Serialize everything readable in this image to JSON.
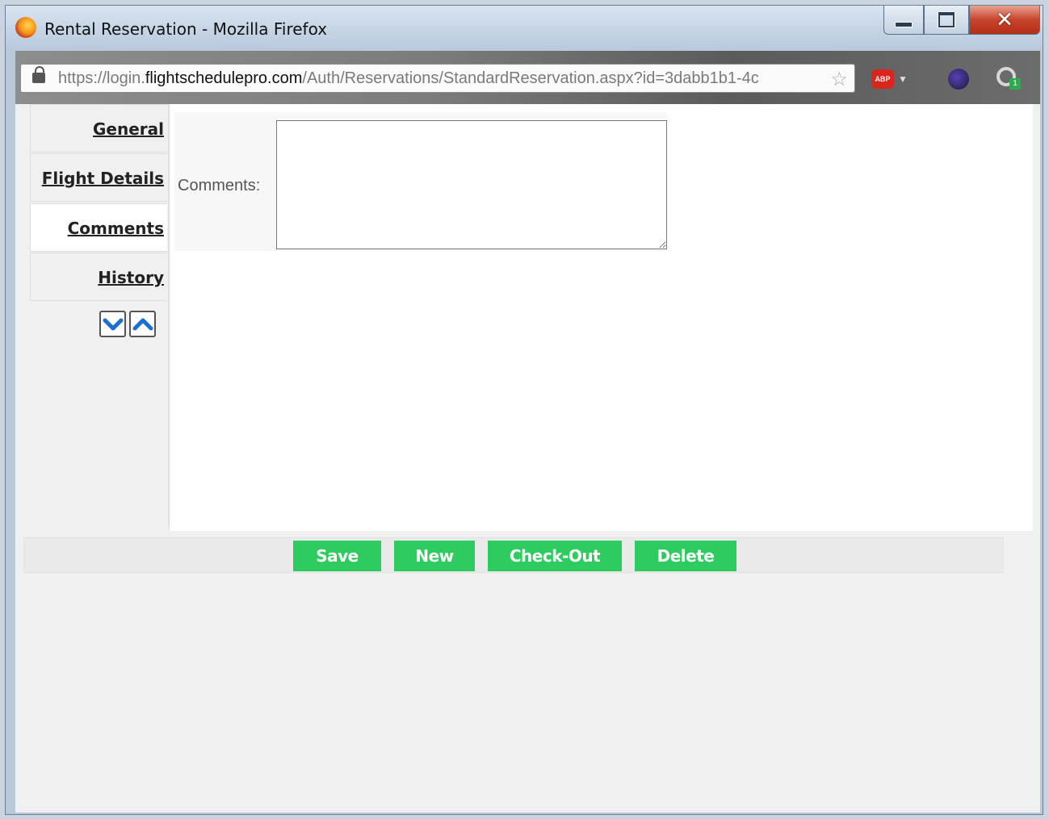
{
  "window": {
    "title": "Rental Reservation - Mozilla Firefox"
  },
  "browser": {
    "url_prefix": "https://login.",
    "url_domain": "flightschedulepro.com",
    "url_path": "/Auth/Reservations/StandardReservation.aspx?id=3dabb1b1-4c",
    "abp_label": "ABP",
    "badge_count": "1"
  },
  "sidebar": {
    "tabs": [
      {
        "label": "General"
      },
      {
        "label": "Flight Details"
      },
      {
        "label": "Comments",
        "active": true
      },
      {
        "label": "History"
      }
    ]
  },
  "comments": {
    "label": "Comments:",
    "value": ""
  },
  "actions": {
    "save": "Save",
    "new": "New",
    "checkout": "Check-Out",
    "delete": "Delete"
  },
  "colors": {
    "action_button": "#2ecc5f",
    "arrow_icon": "#1a6fd6"
  }
}
